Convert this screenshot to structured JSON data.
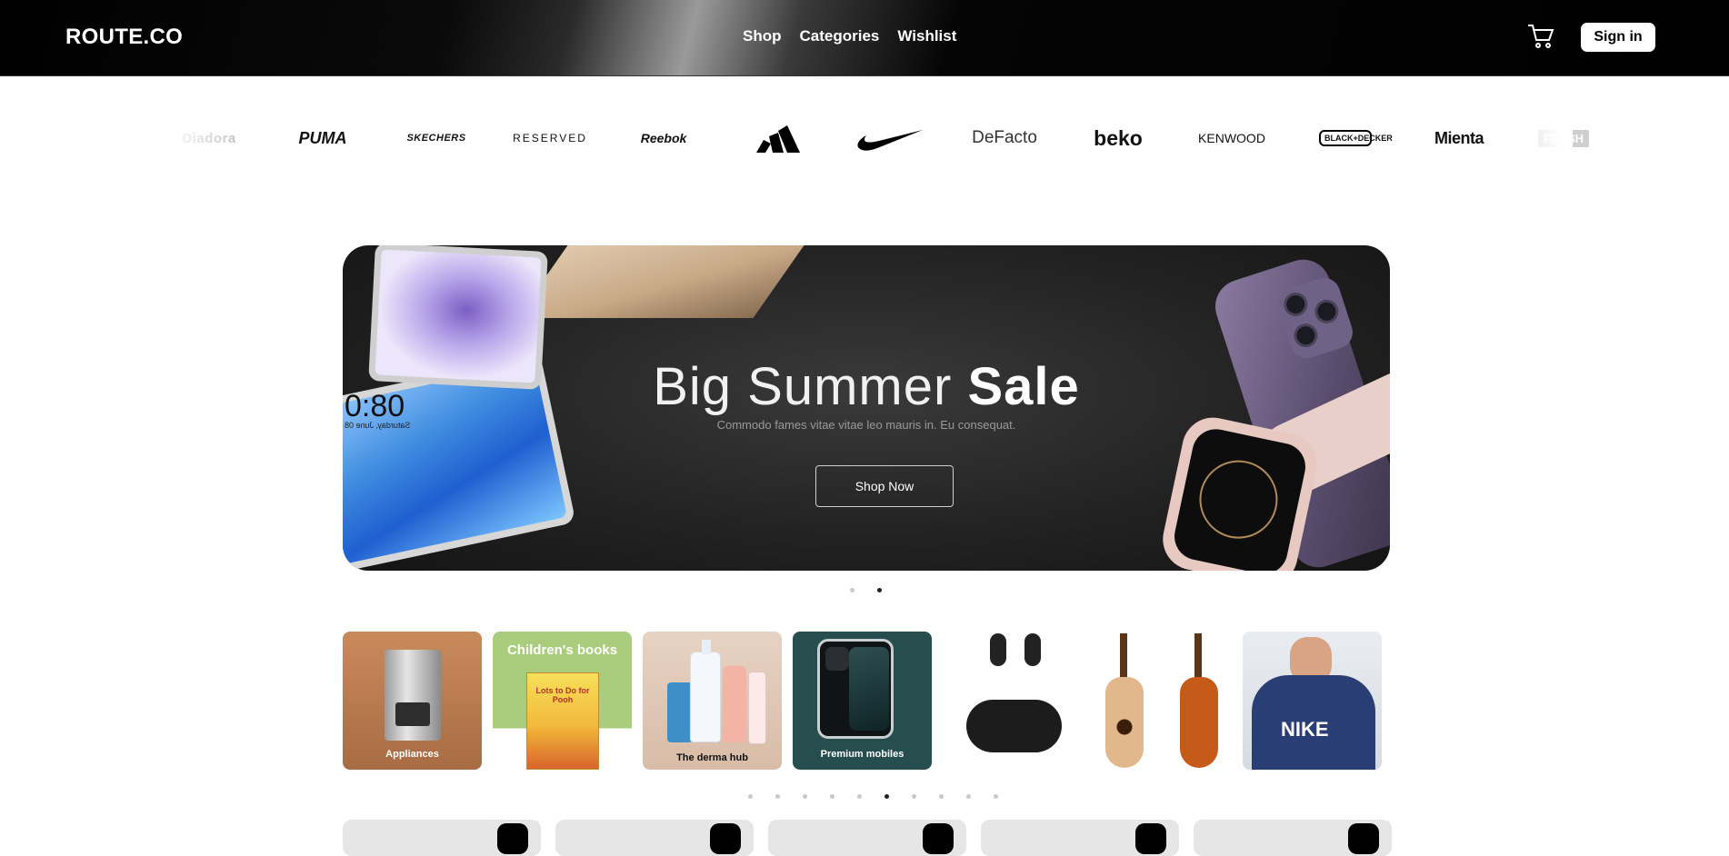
{
  "header": {
    "brand": "ROUTE.CO",
    "nav": [
      {
        "label": "Shop"
      },
      {
        "label": "Categories"
      },
      {
        "label": "Wishlist"
      }
    ],
    "cart_icon": "cart-icon",
    "signin_label": "Sign in"
  },
  "brands": [
    "Diadora",
    "PUMA",
    "SKECHERS",
    "RESERVED",
    "Reebok",
    "adidas",
    "nike",
    "DeFacto",
    "beko",
    "KENWOOD",
    "BLACK+DECKER",
    "Mienta",
    "FRESH"
  ],
  "hero": {
    "title_light": "Big Summer",
    "title_bold": "Sale",
    "subtitle": "Commodo fames vitae vitae leo mauris in. Eu consequat.",
    "button": "Shop Now",
    "tablet_time": "0:80",
    "tablet_date": "Saturday, June 08"
  },
  "hero_carousel": {
    "count": 2,
    "active": 2
  },
  "categories": [
    {
      "label": "Appliances"
    },
    {
      "label": "Children's books",
      "book_title": "Lots to Do for Pooh"
    },
    {
      "label": "The derma hub"
    },
    {
      "label": "Premium mobiles"
    },
    {
      "label": ""
    },
    {
      "label": ""
    },
    {
      "label": "",
      "logo": "NIKE"
    }
  ],
  "category_carousel": {
    "count": 10,
    "active": 6
  },
  "colors": {
    "header_bg": "#000000",
    "accent": "#ffffff",
    "hero_bg": "#232323"
  }
}
